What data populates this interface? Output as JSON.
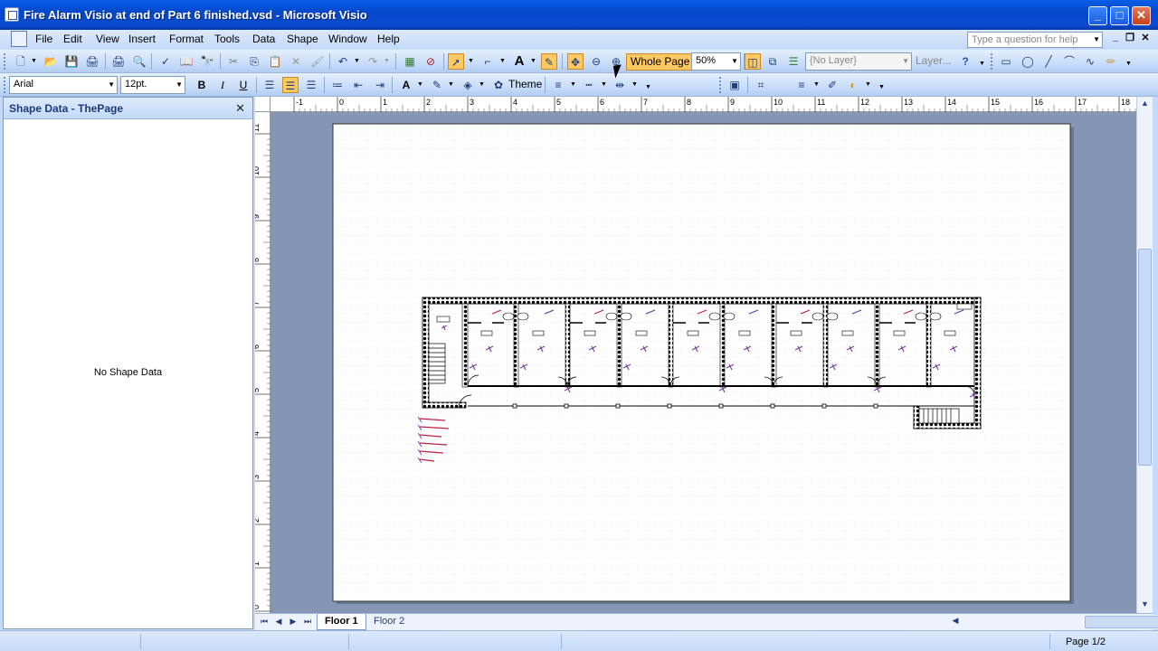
{
  "window": {
    "title": "Fire Alarm Visio at end of Part 6 finished.vsd - Microsoft Visio",
    "minimize": "_",
    "maximize": "□",
    "close": "✕"
  },
  "menu": {
    "items": [
      "File",
      "Edit",
      "View",
      "Insert",
      "Format",
      "Tools",
      "Data",
      "Shape",
      "Window",
      "Help"
    ],
    "ask_placeholder": "Type a question for help"
  },
  "toolbar": {
    "whole_page": "Whole Page",
    "zoom": "50%",
    "layer": "{No Layer}",
    "layers_label": "Layer...",
    "font_name": "Arial",
    "font_size": "12pt.",
    "bold": "B",
    "italic": "I",
    "underline": "U",
    "theme": "Theme"
  },
  "shape_data_pane": {
    "title": "Shape Data - ThePage",
    "empty_text": "No Shape Data"
  },
  "ruler": {
    "h_labels": [
      "-1",
      "0",
      "1",
      "2",
      "3",
      "4",
      "5",
      "6",
      "7",
      "8",
      "9",
      "10",
      "11",
      "12",
      "13",
      "14",
      "15",
      "16",
      "17",
      "18"
    ],
    "v_labels": [
      "11",
      "10",
      "9",
      "8",
      "7",
      "6",
      "5",
      "4",
      "3",
      "2",
      "1",
      "0"
    ]
  },
  "tabs": {
    "pages": [
      "Floor 1",
      "Floor 2"
    ],
    "active": "Floor 1"
  },
  "status": {
    "page_indicator": "Page 1/2"
  },
  "icons": [
    "app-icon",
    "new-icon",
    "open-icon",
    "save-icon",
    "permission-icon",
    "print-icon",
    "print-preview-icon",
    "spelling-icon",
    "research-icon",
    "find-icon",
    "cut-icon",
    "copy-icon",
    "paste-icon",
    "delete-icon",
    "format-painter-icon",
    "undo-icon",
    "redo-icon",
    "shapes-icon",
    "connector-icon",
    "text-tool-icon",
    "pointer-icon",
    "zoom-in-icon",
    "zoom-out-icon",
    "pan-icon",
    "help-icon",
    "rectangle-icon",
    "ellipse-icon",
    "line-icon",
    "arc-icon",
    "freeform-icon",
    "pencil-icon"
  ],
  "colors": {
    "accent": "#ffc860",
    "title_bar": "#0a5ee8",
    "canvas_bg": "#8596b4"
  }
}
